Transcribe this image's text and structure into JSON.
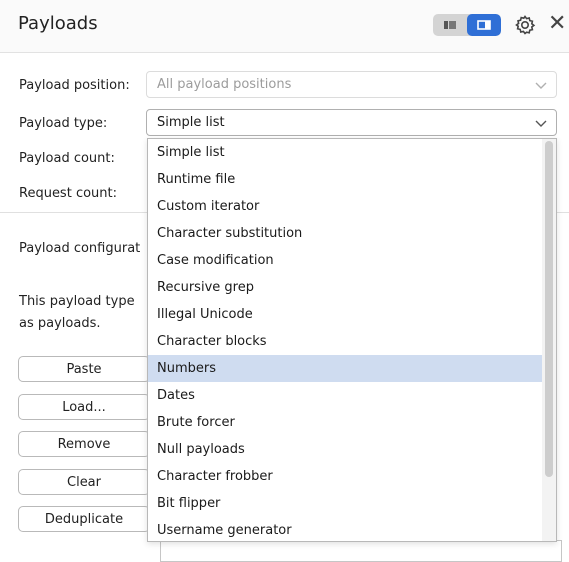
{
  "header": {
    "title": "Payloads",
    "close_glyph": "✕"
  },
  "fields": {
    "payload_position": {
      "label": "Payload position:",
      "value": "All payload positions"
    },
    "payload_type": {
      "label": "Payload type:",
      "value": "Simple list"
    },
    "payload_count": {
      "label": "Payload count:"
    },
    "request_count": {
      "label": "Request count:"
    }
  },
  "config": {
    "heading": "Payload configurat",
    "desc_line1": "This payload type",
    "desc_line2": "as payloads."
  },
  "buttons": {
    "paste": "Paste",
    "load": "Load...",
    "remove": "Remove",
    "clear": "Clear",
    "deduplicate": "Deduplicate"
  },
  "dropdown": {
    "options": [
      "Simple list",
      "Runtime file",
      "Custom iterator",
      "Character substitution",
      "Case modification",
      "Recursive grep",
      "Illegal Unicode",
      "Character blocks",
      "Numbers",
      "Dates",
      "Brute forcer",
      "Null payloads",
      "Character frobber",
      "Bit flipper",
      "Username generator"
    ],
    "highlighted": "Numbers"
  },
  "colors": {
    "accent": "#2f6fd6",
    "highlight": "#cfdcf0"
  }
}
